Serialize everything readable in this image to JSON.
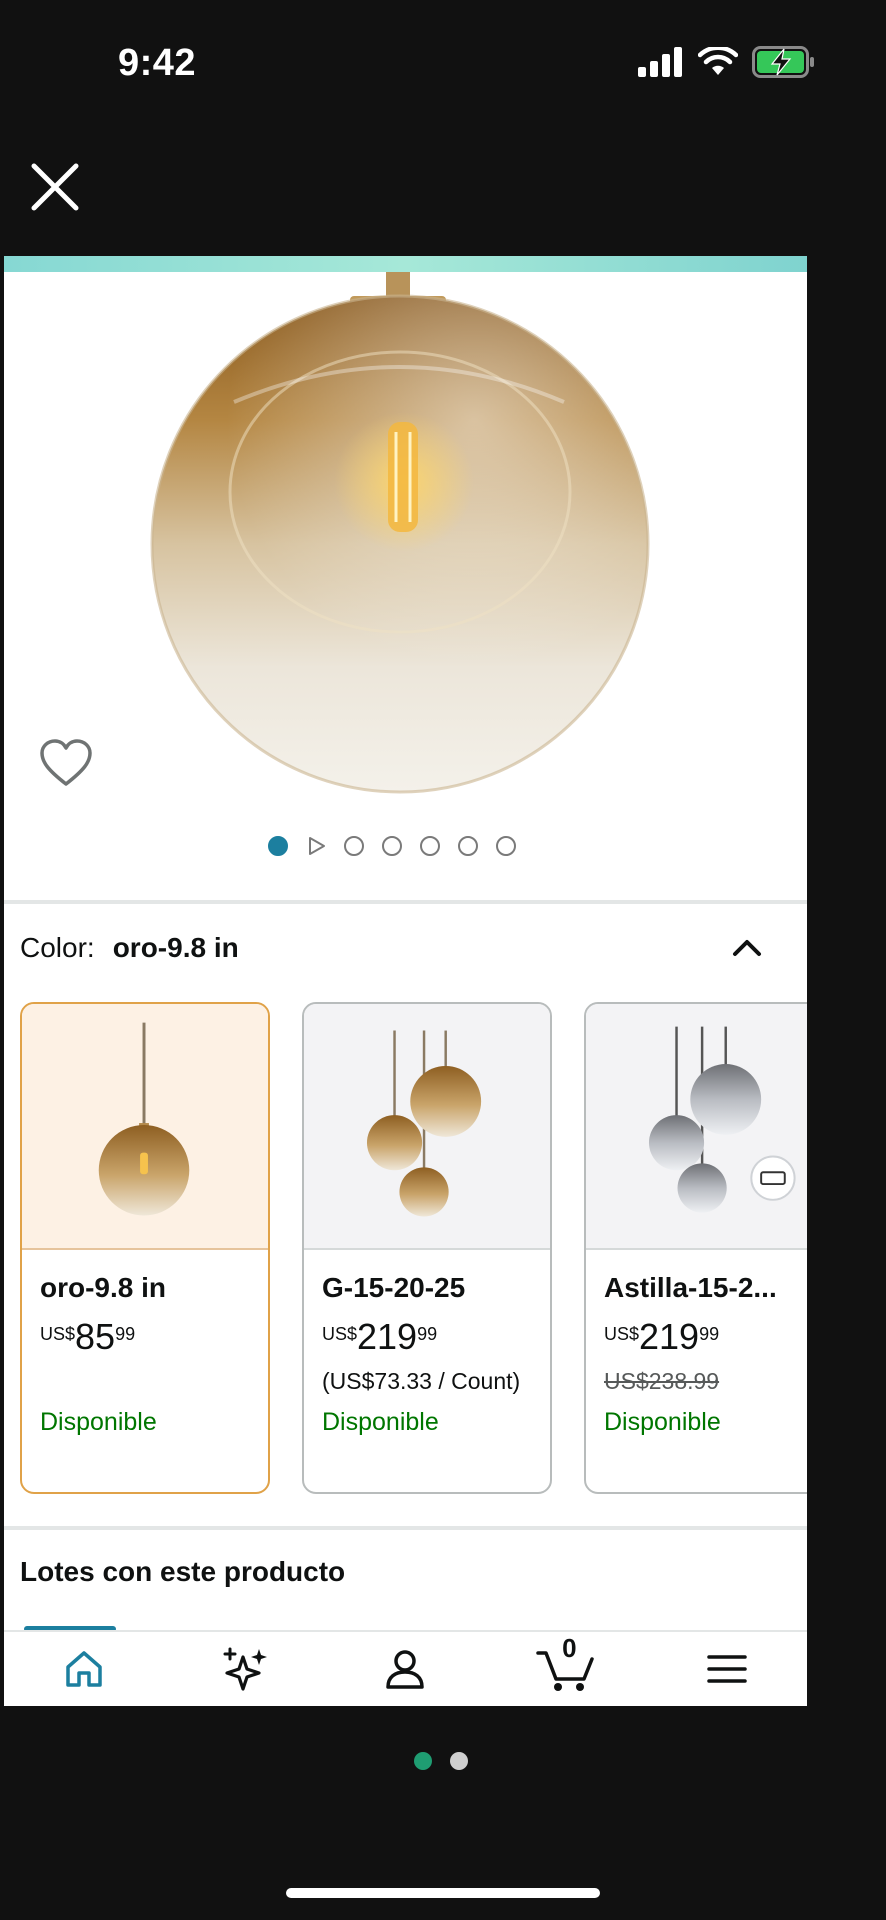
{
  "status_bar": {
    "time": "9:42"
  },
  "gallery": {
    "image_count": 7,
    "active_index": 0
  },
  "color_selector": {
    "label": "Color:",
    "selected": "oro-9.8 in"
  },
  "variants": [
    {
      "name": "oro-9.8 in",
      "currency": "US$",
      "price_whole": "85",
      "price_fraction": "99",
      "sub": "",
      "availability": "Disponible",
      "selected": true
    },
    {
      "name": "G-15-20-25",
      "currency": "US$",
      "price_whole": "219",
      "price_fraction": "99",
      "sub": "(US$73.33 / Count)",
      "availability": "Disponible",
      "selected": false
    },
    {
      "name": "Astilla-15-2...",
      "currency": "US$",
      "price_whole": "219",
      "price_fraction": "99",
      "sub": "US$238.99",
      "availability": "Disponible",
      "selected": false
    }
  ],
  "section": {
    "bundles_title": "Lotes con este producto"
  },
  "bottom_nav": {
    "cart_count": "0",
    "items": [
      "home",
      "ai-assistant",
      "account",
      "cart",
      "menu"
    ]
  },
  "colors": {
    "accent": "#1c7f9f",
    "available": "#007600",
    "selected_border": "#e0a248"
  }
}
